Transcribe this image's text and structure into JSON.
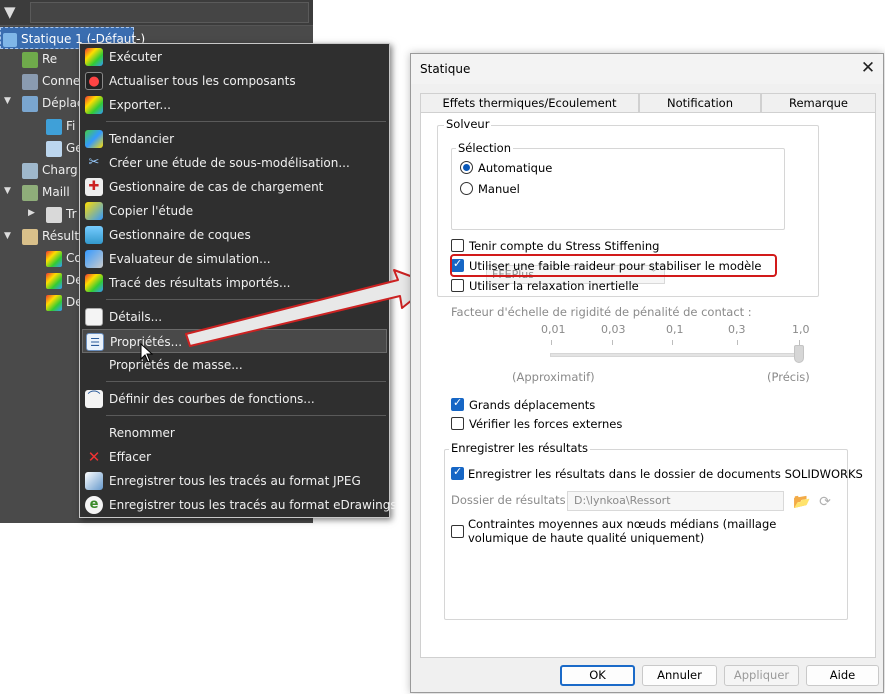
{
  "tree": {
    "study": "Statique 1 (-Défaut-)",
    "nodes": [
      "Re",
      "Conne",
      "Déplac",
      "Fi",
      "Ge",
      "Charg",
      "Maill",
      "Tr",
      "Résult",
      "Co",
      "De",
      "De"
    ]
  },
  "menu": {
    "items": [
      "Exécuter",
      "Actualiser tous les composants",
      "Exporter...",
      "Tendancier",
      "Créer une étude de sous-modélisation...",
      "Gestionnaire de cas de chargement",
      "Copier l'étude",
      "Gestionnaire de coques",
      "Evaluateur de simulation...",
      "Tracé des résultats importés...",
      "Détails...",
      "Propriétés...",
      "Propriétés de masse...",
      "Définir des courbes de fonctions...",
      "Renommer",
      "Effacer",
      "Enregistrer tous les tracés au format JPEG",
      "Enregistrer tous les tracés au format eDrawings"
    ]
  },
  "dialog": {
    "title": "Statique",
    "tabs": [
      "Effets thermiques/Ecoulement",
      "Notification",
      "Remarque"
    ],
    "solver_group": "Solveur",
    "selection_group": "Sélection",
    "radio_auto": "Automatique",
    "radio_manual": "Manuel",
    "solver_value": "FFEPlus",
    "stress_stiffening": "Tenir compte du Stress Stiffening",
    "soft_spring": "Utiliser une faible raideur pour stabiliser le modèle",
    "inertial_relief": "Utiliser la relaxation inertielle",
    "penalty_label": "Facteur d'échelle de rigidité de pénalité de contact :",
    "ticks": [
      "0,01",
      "0,03",
      "0,1",
      "0,3",
      "1,0"
    ],
    "slider_value_fraction": 1.0,
    "approx_label": "(Approximatif)",
    "precise_label": "(Précis)",
    "large_displacement": "Grands déplacements",
    "free_body": "Vérifier les forces externes",
    "results_group": "Enregistrer les résultats",
    "save_results": "Enregistrer les résultats dans le dossier de documents SOLIDWORKS",
    "results_folder_label": "Dossier de résultats",
    "results_folder_value": "D:\\lynkoa\\Ressort",
    "avg_stress_line1": "Contraintes moyennes aux nœuds médians (maillage",
    "avg_stress_line2": "volumique de haute qualité uniquement)",
    "buttons": {
      "ok": "OK",
      "cancel": "Annuler",
      "apply": "Appliquer",
      "help": "Aide"
    }
  },
  "colors": {
    "highlight": "#d21a1a",
    "accent": "#1666c5",
    "menu_bg": "#2f2f2f",
    "tree_bg": "#4a4a4a"
  }
}
